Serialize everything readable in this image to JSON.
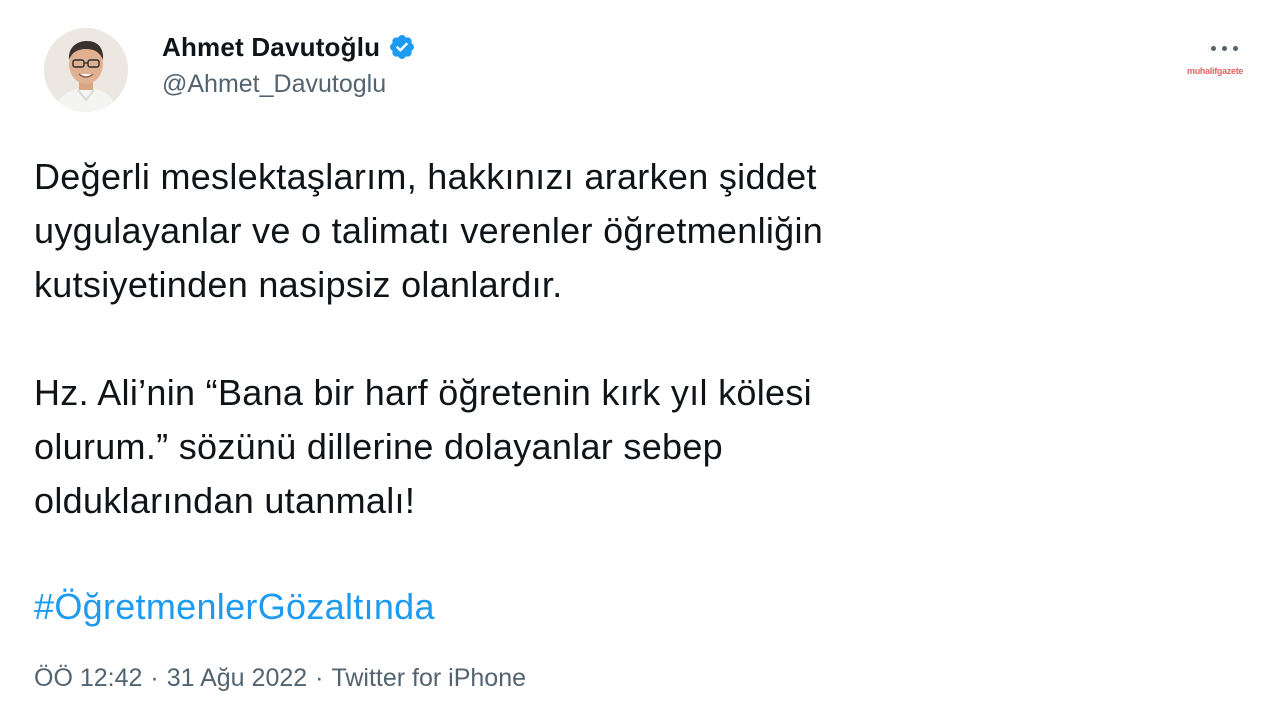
{
  "author": {
    "display_name": "Ahmet Davutoğlu",
    "handle": "@Ahmet_Davutoglu",
    "verified": true,
    "verified_color": "#1d9bf0"
  },
  "icons": {
    "verified": "verified-badge-icon",
    "more": "more-horizontal-icon"
  },
  "watermark_text": "muhalifgazete",
  "tweet": {
    "paragraph_1": "Değerli meslektaşlarım, hakkınızı ararken şiddet\nuygulayanlar ve o talimatı verenler öğretmenliğin\nkutsiyetinden nasipsiz olanlardır.",
    "paragraph_2": "Hz. Ali’nin “Bana bir harf öğretenin kırk yıl kölesi\nolurum.” sözünü dillerine dolayanlar sebep\nolduklarından utanmalı!",
    "hashtag": "#ÖğretmenlerGözaltında"
  },
  "meta": {
    "time": "ÖÖ 12:42",
    "separator": "·",
    "date": "31 Ağu 2022",
    "source": "Twitter for iPhone"
  },
  "colors": {
    "text": "#0f1419",
    "secondary": "#536471",
    "link": "#1d9bf0"
  }
}
